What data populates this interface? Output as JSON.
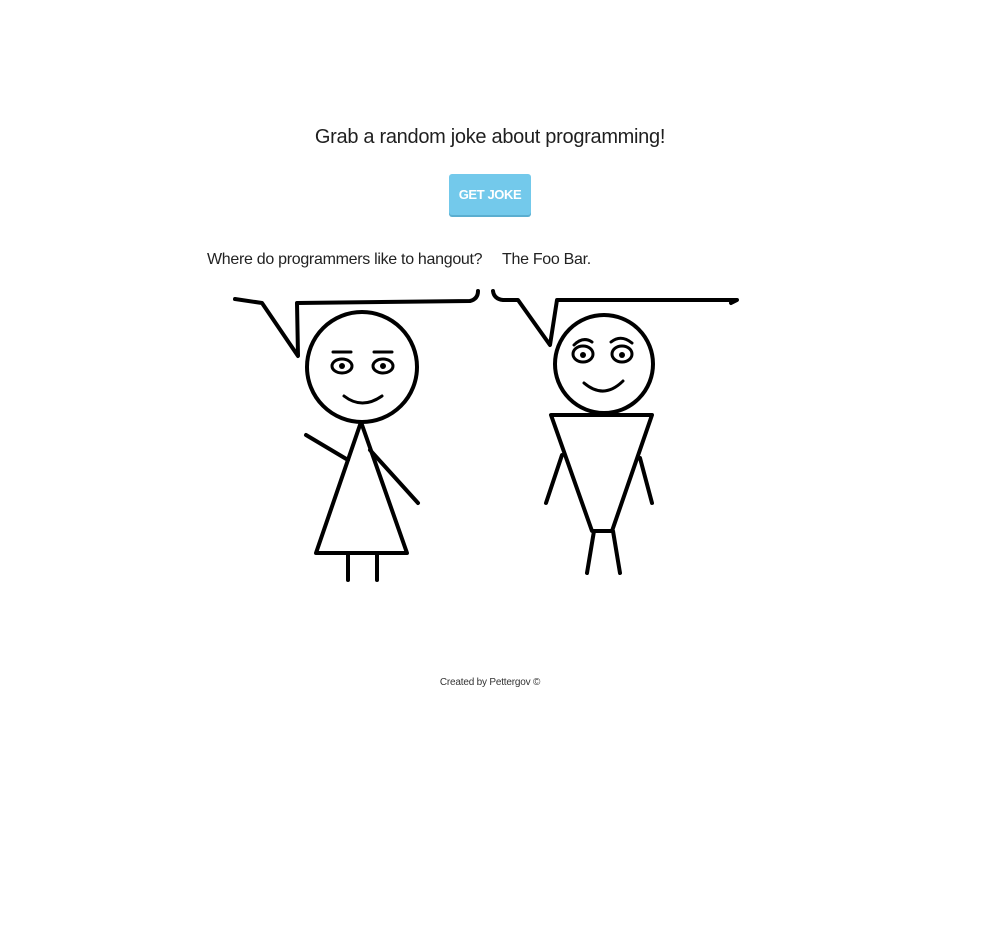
{
  "header": {
    "title": "Grab a random joke about programming!"
  },
  "actions": {
    "get_joke_label": "GET JOKE"
  },
  "joke": {
    "setup": "Where do programmers like to hangout?",
    "punchline": "The Foo Bar."
  },
  "footer": {
    "credit": "Created by Pettergov ©"
  },
  "colors": {
    "button_bg": "#73c9eb",
    "button_text": "#ffffff",
    "ink": "#000000"
  }
}
